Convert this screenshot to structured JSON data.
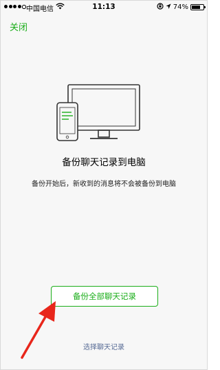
{
  "status_bar": {
    "carrier": "中国电信",
    "time": "11:13",
    "battery_text": "74%",
    "battery_level": 0.74
  },
  "nav": {
    "close_label": "关闭"
  },
  "main": {
    "title": "备份聊天记录到电脑",
    "description": "备份开始后，新收到的消息将不会被备份到电脑",
    "backup_all_button": "备份全部聊天记录",
    "select_records_link": "选择聊天记录"
  },
  "colors": {
    "accent": "#1aad19",
    "link": "#576b95",
    "annotation_arrow": "#e8261b"
  }
}
